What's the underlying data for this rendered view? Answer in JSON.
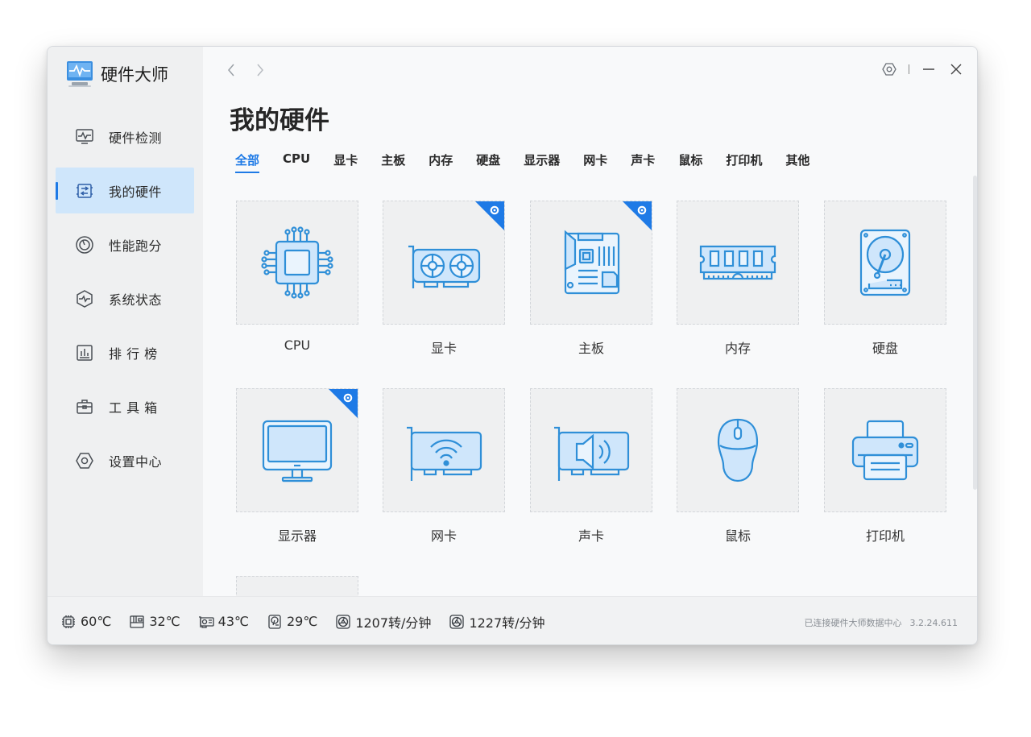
{
  "app": {
    "title": "硬件大师"
  },
  "sidebar": {
    "items": [
      {
        "label": "硬件检测",
        "icon": "monitor-pulse-icon",
        "active": false
      },
      {
        "label": "我的硬件",
        "icon": "board-chip-icon",
        "active": true
      },
      {
        "label": "性能跑分",
        "icon": "speedometer-icon",
        "active": false
      },
      {
        "label": "系统状态",
        "icon": "hexagon-pulse-icon",
        "active": false
      },
      {
        "label": "排 行 榜",
        "icon": "bar-chart-icon",
        "active": false
      },
      {
        "label": "工 具 箱",
        "icon": "toolbox-icon",
        "active": false
      },
      {
        "label": "设置中心",
        "icon": "settings-hex-icon",
        "active": false
      }
    ]
  },
  "main": {
    "title": "我的硬件",
    "tabs": [
      {
        "label": "全部",
        "active": true
      },
      {
        "label": "CPU",
        "active": false
      },
      {
        "label": "显卡",
        "active": false
      },
      {
        "label": "主板",
        "active": false
      },
      {
        "label": "内存",
        "active": false
      },
      {
        "label": "硬盘",
        "active": false
      },
      {
        "label": "显示器",
        "active": false
      },
      {
        "label": "网卡",
        "active": false
      },
      {
        "label": "声卡",
        "active": false
      },
      {
        "label": "鼠标",
        "active": false
      },
      {
        "label": "打印机",
        "active": false
      },
      {
        "label": "其他",
        "active": false
      }
    ],
    "cards": [
      {
        "label": "CPU",
        "icon": "cpu-icon",
        "badge": false
      },
      {
        "label": "显卡",
        "icon": "graphics-card-icon",
        "badge": true
      },
      {
        "label": "主板",
        "icon": "motherboard-icon",
        "badge": true
      },
      {
        "label": "内存",
        "icon": "ram-icon",
        "badge": false
      },
      {
        "label": "硬盘",
        "icon": "hard-disk-icon",
        "badge": false
      },
      {
        "label": "显示器",
        "icon": "monitor-icon",
        "badge": true
      },
      {
        "label": "网卡",
        "icon": "network-card-icon",
        "badge": false
      },
      {
        "label": "声卡",
        "icon": "sound-card-icon",
        "badge": false
      },
      {
        "label": "鼠标",
        "icon": "mouse-icon",
        "badge": false
      },
      {
        "label": "打印机",
        "icon": "printer-icon",
        "badge": false
      },
      {
        "label": "",
        "icon": "",
        "badge": false
      }
    ]
  },
  "status": {
    "items": [
      {
        "icon": "cpu-temp-icon",
        "value": "60℃"
      },
      {
        "icon": "board-temp-icon",
        "value": "32℃"
      },
      {
        "icon": "gpu-temp-icon",
        "value": "43℃"
      },
      {
        "icon": "disk-temp-icon",
        "value": "29℃"
      },
      {
        "icon": "fan-icon",
        "value": "1207转/分钟"
      },
      {
        "icon": "fan-icon",
        "value": "1227转/分钟"
      }
    ],
    "connection": "已连接硬件大师数据中心",
    "version": "3.2.24.611"
  },
  "colors": {
    "accent": "#1e7ae6",
    "icon_stroke": "#2f8fd8",
    "icon_fill": "#cfe6fb"
  }
}
